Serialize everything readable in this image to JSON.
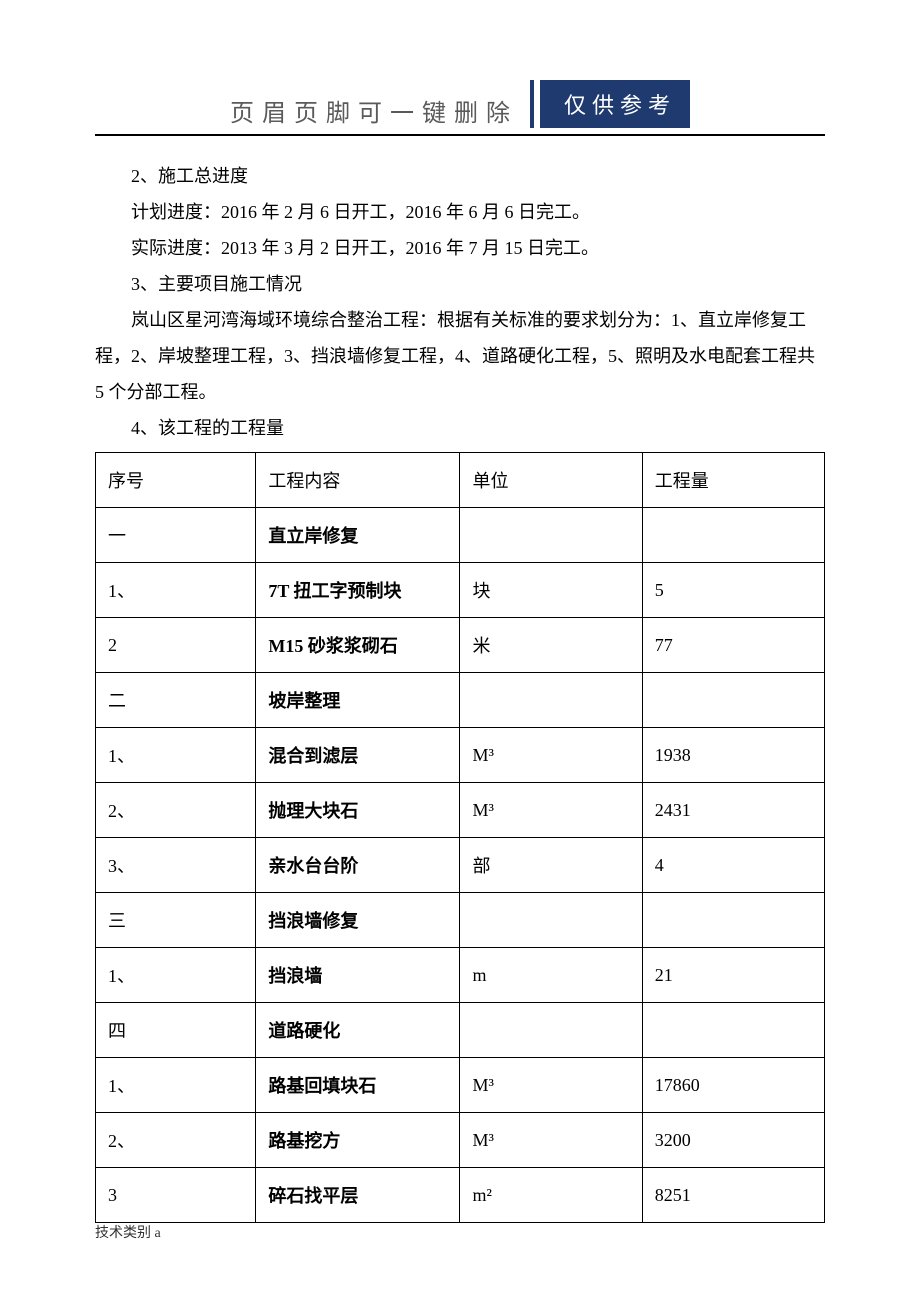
{
  "header": {
    "title": "页眉页脚可一键删除",
    "badge": "仅供参考"
  },
  "body": {
    "p1": "2、施工总进度",
    "p2": "计划进度：2016 年 2 月 6 日开工，2016 年 6 月 6 日完工。",
    "p3": "实际进度：2013 年 3 月 2 日开工，2016 年 7 月 15 日完工。",
    "p4": "3、主要项目施工情况",
    "p5": "岚山区星河湾海域环境综合整治工程：根据有关标准的要求划分为：1、直立岸修复工程，2、岸坡整理工程，3、挡浪墙修复工程，4、道路硬化工程，5、照明及水电配套工程共 5 个分部工程。",
    "p6": "4、该工程的工程量"
  },
  "table": {
    "headers": {
      "seq": "序号",
      "content": "工程内容",
      "unit": "单位",
      "qty": "工程量"
    },
    "rows": [
      {
        "seq": "一",
        "content": "直立岸修复",
        "unit": "",
        "qty": ""
      },
      {
        "seq": "1、",
        "content": "7T 扭工字预制块",
        "unit": "块",
        "qty": "5"
      },
      {
        "seq": "2",
        "content": "M15 砂浆浆砌石",
        "unit": "米",
        "qty": "77"
      },
      {
        "seq": "二",
        "content": "坡岸整理",
        "unit": "",
        "qty": ""
      },
      {
        "seq": "1、",
        "content": "混合到滤层",
        "unit": "M³",
        "qty": "1938"
      },
      {
        "seq": "2、",
        "content": "抛理大块石",
        "unit": "M³",
        "qty": "2431"
      },
      {
        "seq": "3、",
        "content": "亲水台台阶",
        "unit": "部",
        "qty": "4"
      },
      {
        "seq": "三",
        "content": "挡浪墙修复",
        "unit": "",
        "qty": ""
      },
      {
        "seq": "1、",
        "content": "挡浪墙",
        "unit": "m",
        "qty": "21"
      },
      {
        "seq": "四",
        "content": "道路硬化",
        "unit": "",
        "qty": ""
      },
      {
        "seq": "1、",
        "content": "路基回填块石",
        "unit": "M³",
        "qty": "17860"
      },
      {
        "seq": "2、",
        "content": "路基挖方",
        "unit": "M³",
        "qty": "3200"
      },
      {
        "seq": "3",
        "content": "碎石找平层",
        "unit": "m²",
        "qty": "8251"
      }
    ]
  },
  "footer": "技术类别 a"
}
